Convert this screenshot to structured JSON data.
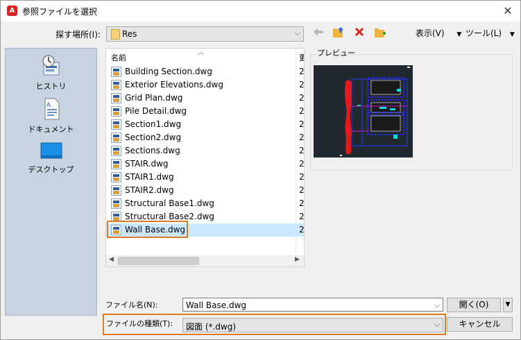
{
  "window": {
    "title": "参照ファイルを選択",
    "app_icon_letter": "A",
    "close_glyph": "✕"
  },
  "lookin": {
    "label": "探す場所(I):",
    "value": "Res"
  },
  "toolbar": {
    "back_icon": "back-arrow-icon",
    "view_label": "表示(V)",
    "tools_label": "ツール(L)"
  },
  "places": [
    {
      "label": "ヒストリ",
      "icon": "history-icon"
    },
    {
      "label": "ドキュメント",
      "icon": "documents-icon"
    },
    {
      "label": "デスクトップ",
      "icon": "desktop-icon"
    }
  ],
  "filelist": {
    "col_name": "名前",
    "col_date": "更",
    "files": [
      {
        "name": "Building Section.dwg",
        "date": "2"
      },
      {
        "name": "Exterior Elevations.dwg",
        "date": "2"
      },
      {
        "name": "Grid Plan.dwg",
        "date": "2"
      },
      {
        "name": "Pile Detail.dwg",
        "date": "2"
      },
      {
        "name": "Section1.dwg",
        "date": "2"
      },
      {
        "name": "Section2.dwg",
        "date": "2"
      },
      {
        "name": "Sections.dwg",
        "date": "2"
      },
      {
        "name": "STAIR.dwg",
        "date": "2"
      },
      {
        "name": "STAIR1.dwg",
        "date": "2"
      },
      {
        "name": "STAIR2.dwg",
        "date": "2"
      },
      {
        "name": "Structural Base1.dwg",
        "date": "2"
      },
      {
        "name": "Structural Base2.dwg",
        "date": "2"
      },
      {
        "name": "Wall Base.dwg",
        "date": "2",
        "selected": true
      }
    ]
  },
  "preview": {
    "label": "プレビュー"
  },
  "filename": {
    "label": "ファイル名(N):",
    "value": "Wall Base.dwg"
  },
  "filetype": {
    "label": "ファイルの種類(T):",
    "value": "図面 (*.dwg)"
  },
  "buttons": {
    "open": "開く(O)",
    "cancel": "キャンセル"
  },
  "colors": {
    "highlight": "#e07a22",
    "selected_row": "#cce8ff",
    "places_bg": "#c7d3e0"
  }
}
